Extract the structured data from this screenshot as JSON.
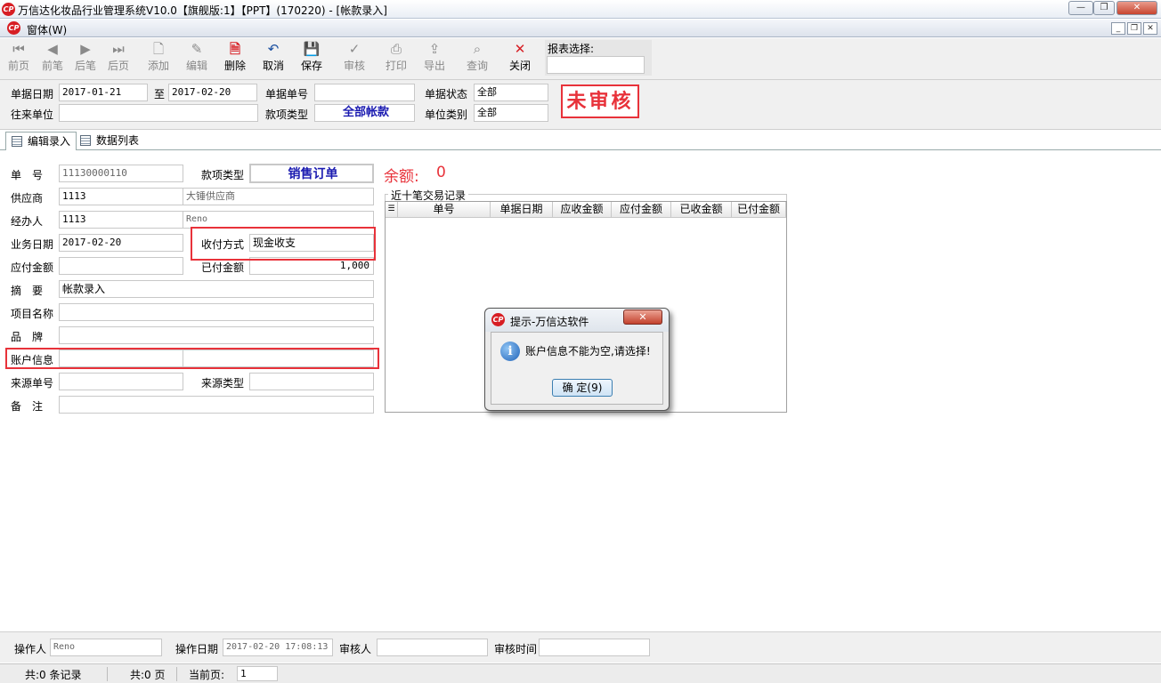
{
  "window": {
    "title": "万信达化妆品行业管理系统V10.0【旗舰版:1】【PPT】(170220) - [帐款录入]",
    "logo_text": "CP"
  },
  "menubar": {
    "menu_label": "窗体(W)"
  },
  "toolbar": {
    "buttons": [
      {
        "label": "前页",
        "icon": "first-icon"
      },
      {
        "label": "前笔",
        "icon": "prev-icon"
      },
      {
        "label": "后笔",
        "icon": "next-icon"
      },
      {
        "label": "后页",
        "icon": "last-icon"
      },
      {
        "label": "添加",
        "icon": "add-icon"
      },
      {
        "label": "编辑",
        "icon": "edit-icon"
      },
      {
        "label": "删除",
        "icon": "delete-icon"
      },
      {
        "label": "取消",
        "icon": "undo-icon"
      },
      {
        "label": "保存",
        "icon": "save-icon"
      },
      {
        "label": "审核",
        "icon": "audit-icon"
      },
      {
        "label": "打印",
        "icon": "print-icon"
      },
      {
        "label": "导出",
        "icon": "export-icon"
      },
      {
        "label": "查询",
        "icon": "query-icon"
      },
      {
        "label": "关闭",
        "icon": "close-icon"
      }
    ],
    "report_label": "报表选择:",
    "report_value": ""
  },
  "filter": {
    "date_label": "单据日期",
    "date_from": "2017-01-21",
    "to_label": "至",
    "date_to": "2017-02-20",
    "docno_label": "单据单号",
    "docno_value": "",
    "status_label": "单据状态",
    "status_value": "全部",
    "partner_label": "往来单位",
    "partner_value": "",
    "type_label": "款项类型",
    "type_value": "全部帐款",
    "unitcat_label": "单位类别",
    "unitcat_value": "全部",
    "stamp": "未审核"
  },
  "tabs": [
    {
      "label": "编辑录入"
    },
    {
      "label": "数据列表"
    }
  ],
  "form": {
    "no_label": "单　号",
    "no_value": "11130000110",
    "type_label": "款项类型",
    "type_value": "销售订单",
    "balance_label": "余额:",
    "balance_value": "0",
    "supplier_label": "供应商",
    "supplier_code": "1113",
    "supplier_name": "大锤供应商",
    "handler_label": "经办人",
    "handler_code": "1113",
    "handler_name": "Reno",
    "bizdate_label": "业务日期",
    "bizdate_value": "2017-02-20",
    "paymethod_label": "收付方式",
    "paymethod_value": "现金收支",
    "payable_label": "应付金额",
    "payable_value": "",
    "paid_label": "已付金额",
    "paid_value": "1,000",
    "summary_label": "摘　要",
    "summary_value": "帐款录入",
    "project_label": "项目名称",
    "project_value": "",
    "brand_label": "品　牌",
    "brand_value": "",
    "account_label": "账户信息",
    "account_value": "",
    "srcno_label": "来源单号",
    "srcno_value": "",
    "srctype_label": "来源类型",
    "srctype_value": "",
    "remark_label": "备　注",
    "remark_value": ""
  },
  "history": {
    "title": "近十笔交易记录",
    "columns": [
      "单号",
      "单据日期",
      "应收金额",
      "应付金额",
      "已收金额",
      "已付金额"
    ]
  },
  "dialog": {
    "title": "提示-万信达软件",
    "message": "账户信息不能为空,请选择!",
    "ok_label": "确 定(9)",
    "close_symbol": "✕"
  },
  "footer": {
    "operator_label": "操作人",
    "operator_value": "Reno",
    "opdate_label": "操作日期",
    "opdate_value": "2017-02-20 17:08:13",
    "auditor_label": "审核人",
    "auditor_value": "",
    "audittime_label": "审核时间",
    "audittime_value": ""
  },
  "statusbar": {
    "records": "共:0 条记录",
    "pages": "共:0 页",
    "current_label": "当前页:",
    "current_value": "1"
  },
  "colors": {
    "accent_red": "#e8323a",
    "blue_text": "#1a1ab0",
    "stamp_red": "#e8323a"
  }
}
